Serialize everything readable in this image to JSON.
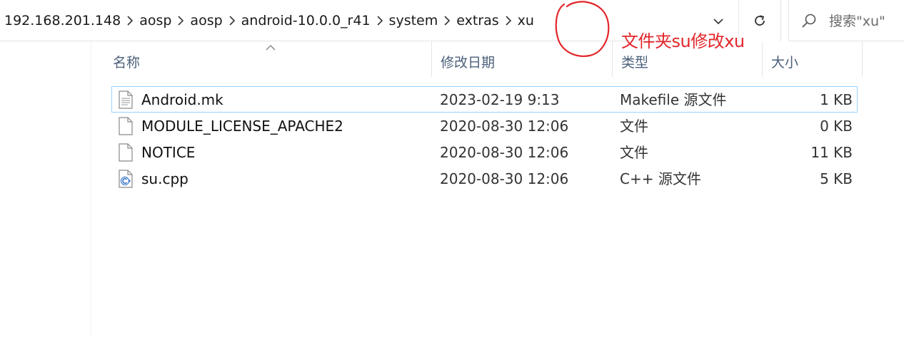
{
  "address_bar": {
    "breadcrumbs": [
      "192.168.201.148",
      "aosp",
      "aosp",
      "android-10.0.0_r41",
      "system",
      "extras",
      "xu"
    ]
  },
  "search": {
    "placeholder": "搜索\"xu\""
  },
  "columns": {
    "name": "名称",
    "date": "修改日期",
    "type": "类型",
    "size": "大小"
  },
  "files": [
    {
      "name": "Android.mk",
      "date": "2023-02-19 9:13",
      "type": "Makefile 源文件",
      "size": "1 KB",
      "icon": "text-file-icon",
      "selected": true
    },
    {
      "name": "MODULE_LICENSE_APACHE2",
      "date": "2020-08-30 12:06",
      "type": "文件",
      "size": "0 KB",
      "icon": "blank-file-icon",
      "selected": false
    },
    {
      "name": "NOTICE",
      "date": "2020-08-30 12:06",
      "type": "文件",
      "size": "11 KB",
      "icon": "blank-file-icon",
      "selected": false
    },
    {
      "name": "su.cpp",
      "date": "2020-08-30 12:06",
      "type": "C++ 源文件",
      "size": "5 KB",
      "icon": "cpp-file-icon",
      "selected": false
    }
  ],
  "annotation": {
    "text": "文件夹su修改xu",
    "color": "#e3262a"
  },
  "colors": {
    "selection_border": "#99d1ff",
    "header_text": "#4c607a"
  }
}
